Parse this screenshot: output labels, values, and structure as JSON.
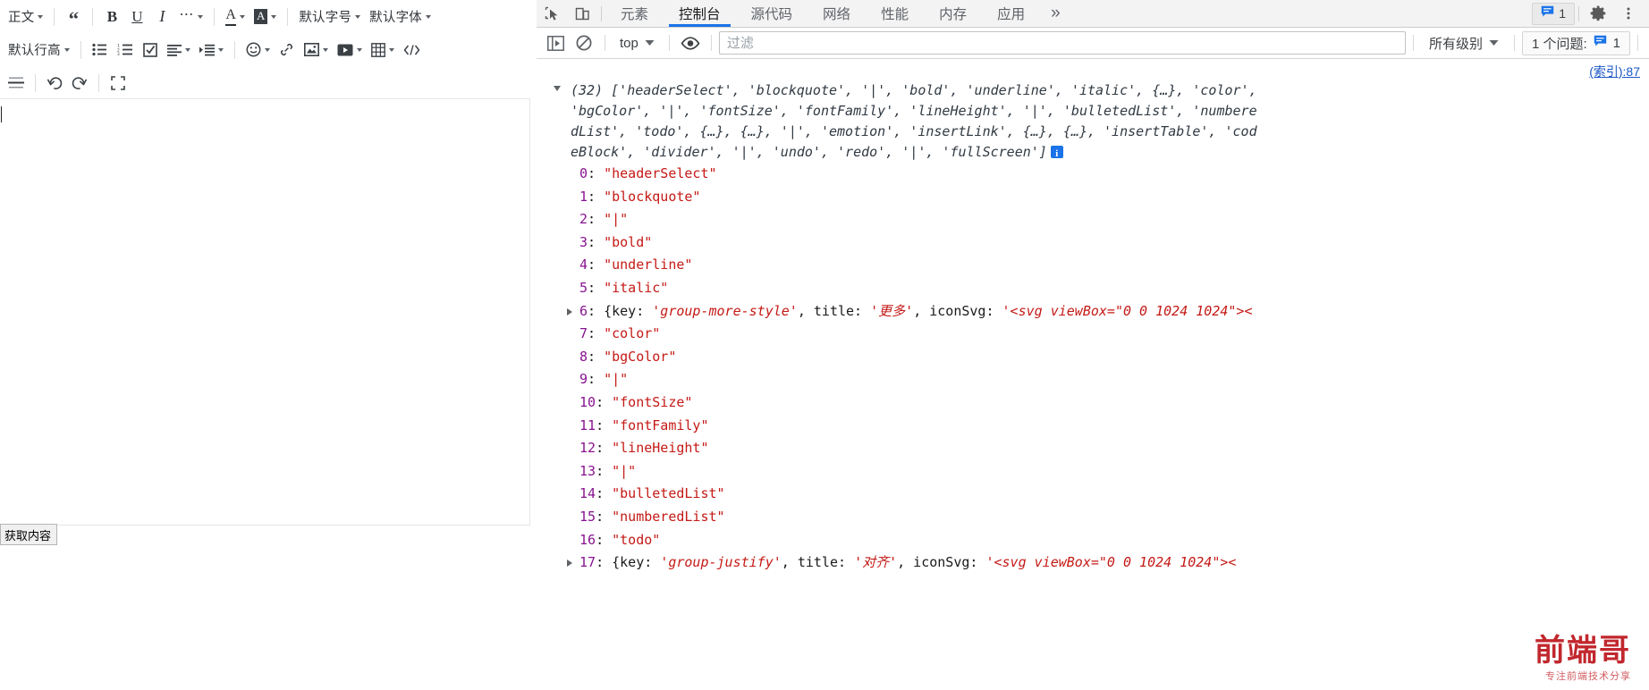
{
  "editor": {
    "toolbar_row1": [
      {
        "type": "text",
        "name": "header-select",
        "label": "正文",
        "caret": true
      },
      {
        "type": "sep"
      },
      {
        "type": "icon",
        "name": "blockquote-button",
        "icon": "quote-icon"
      },
      {
        "type": "sep"
      },
      {
        "type": "icon",
        "name": "bold-button",
        "icon": "bold-icon",
        "glyph": "B"
      },
      {
        "type": "icon",
        "name": "underline-button",
        "icon": "underline-icon",
        "glyph": "U"
      },
      {
        "type": "icon",
        "name": "italic-button",
        "icon": "italic-icon",
        "glyph": "I"
      },
      {
        "type": "icon",
        "name": "more-style-button",
        "icon": "ellipsis-icon",
        "glyph": "···",
        "caret": true
      },
      {
        "type": "sep"
      },
      {
        "type": "icon",
        "name": "font-color-button",
        "icon": "text-color-icon",
        "glyph": "A",
        "caret": true
      },
      {
        "type": "icon",
        "name": "background-color-button",
        "icon": "highlight-color-icon",
        "glyph": "A",
        "caret": true
      },
      {
        "type": "sep"
      },
      {
        "type": "text",
        "name": "font-size-select",
        "label": "默认字号",
        "caret": true
      },
      {
        "type": "text",
        "name": "font-family-select",
        "label": "默认字体",
        "caret": true
      }
    ],
    "toolbar_row2": [
      {
        "type": "text",
        "name": "line-height-select",
        "label": "默认行高",
        "caret": true
      },
      {
        "type": "sep"
      },
      {
        "type": "icon",
        "name": "bulleted-list-button",
        "icon": "bulleted-list-icon"
      },
      {
        "type": "icon",
        "name": "numbered-list-button",
        "icon": "numbered-list-icon"
      },
      {
        "type": "icon",
        "name": "todo-button",
        "icon": "checkbox-icon"
      },
      {
        "type": "icon",
        "name": "justify-button",
        "icon": "align-left-icon",
        "caret": true
      },
      {
        "type": "icon",
        "name": "indent-button",
        "icon": "indent-icon",
        "caret": true
      },
      {
        "type": "sep"
      },
      {
        "type": "icon",
        "name": "emotion-button",
        "icon": "smiley-icon",
        "caret": true
      },
      {
        "type": "icon",
        "name": "insert-link-button",
        "icon": "link-icon"
      },
      {
        "type": "icon",
        "name": "insert-image-button",
        "icon": "image-icon",
        "caret": true
      },
      {
        "type": "icon",
        "name": "insert-video-button",
        "icon": "video-icon",
        "caret": true
      },
      {
        "type": "icon",
        "name": "insert-table-button",
        "icon": "table-icon",
        "caret": true
      },
      {
        "type": "icon",
        "name": "code-block-button",
        "icon": "code-icon"
      }
    ],
    "toolbar_row3": [
      {
        "type": "icon",
        "name": "divider-button",
        "icon": "divider-icon"
      },
      {
        "type": "sep"
      },
      {
        "type": "icon",
        "name": "undo-button",
        "icon": "undo-icon"
      },
      {
        "type": "icon",
        "name": "redo-button",
        "icon": "redo-icon"
      },
      {
        "type": "sep"
      },
      {
        "type": "icon",
        "name": "fullscreen-button",
        "icon": "fullscreen-icon"
      }
    ],
    "get_content_button": "获取内容",
    "content": ""
  },
  "devtools": {
    "tabs": [
      {
        "label": "元素",
        "active": false
      },
      {
        "label": "控制台",
        "active": true
      },
      {
        "label": "源代码",
        "active": false
      },
      {
        "label": "网络",
        "active": false
      },
      {
        "label": "性能",
        "active": false
      },
      {
        "label": "内存",
        "active": false
      },
      {
        "label": "应用",
        "active": false
      }
    ],
    "more_tabs_glyph": "»",
    "issues_count_top": "1",
    "console": {
      "context": "top",
      "filter_placeholder": "过滤",
      "filter_value": "",
      "level": "所有级别",
      "issues_label": "1 个问题:",
      "issues_count": "1",
      "source_link": "(索引):87"
    },
    "log": {
      "array_length": "(32)",
      "preview_lines": [
        "(32) ['headerSelect', 'blockquote', '|', 'bold', 'underline', 'italic', {…}, 'color',",
        "'bgColor', '|', 'fontSize', 'fontFamily', 'lineHeight', '|', 'bulletedList', 'numbere",
        "dList', 'todo', {…}, {…}, '|', 'emotion', 'insertLink', {…}, {…}, 'insertTable', 'cod",
        "eBlock', 'divider', '|', 'undo', 'redo', '|', 'fullScreen']"
      ],
      "entries": [
        {
          "index": "0",
          "kind": "string",
          "value": "\"headerSelect\""
        },
        {
          "index": "1",
          "kind": "string",
          "value": "\"blockquote\""
        },
        {
          "index": "2",
          "kind": "string",
          "value": "\"|\""
        },
        {
          "index": "3",
          "kind": "string",
          "value": "\"bold\""
        },
        {
          "index": "4",
          "kind": "string",
          "value": "\"underline\""
        },
        {
          "index": "5",
          "kind": "string",
          "value": "\"italic\""
        },
        {
          "index": "6",
          "kind": "object",
          "key": "'group-more-style'",
          "title": "'更多'",
          "svg": "'<svg viewBox=\"0 0 1024 1024\"><"
        },
        {
          "index": "7",
          "kind": "string",
          "value": "\"color\""
        },
        {
          "index": "8",
          "kind": "string",
          "value": "\"bgColor\""
        },
        {
          "index": "9",
          "kind": "string",
          "value": "\"|\""
        },
        {
          "index": "10",
          "kind": "string",
          "value": "\"fontSize\""
        },
        {
          "index": "11",
          "kind": "string",
          "value": "\"fontFamily\""
        },
        {
          "index": "12",
          "kind": "string",
          "value": "\"lineHeight\""
        },
        {
          "index": "13",
          "kind": "string",
          "value": "\"|\""
        },
        {
          "index": "14",
          "kind": "string",
          "value": "\"bulletedList\""
        },
        {
          "index": "15",
          "kind": "string",
          "value": "\"numberedList\""
        },
        {
          "index": "16",
          "kind": "string",
          "value": "\"todo\""
        },
        {
          "index": "17",
          "kind": "object",
          "key": "'group-justify'",
          "title": "'对齐'",
          "svg": "'<svg viewBox=\"0 0 1024 1024\"><"
        }
      ]
    }
  },
  "watermark": {
    "title": "前端哥",
    "subtitle": "专注前端技术分享"
  }
}
